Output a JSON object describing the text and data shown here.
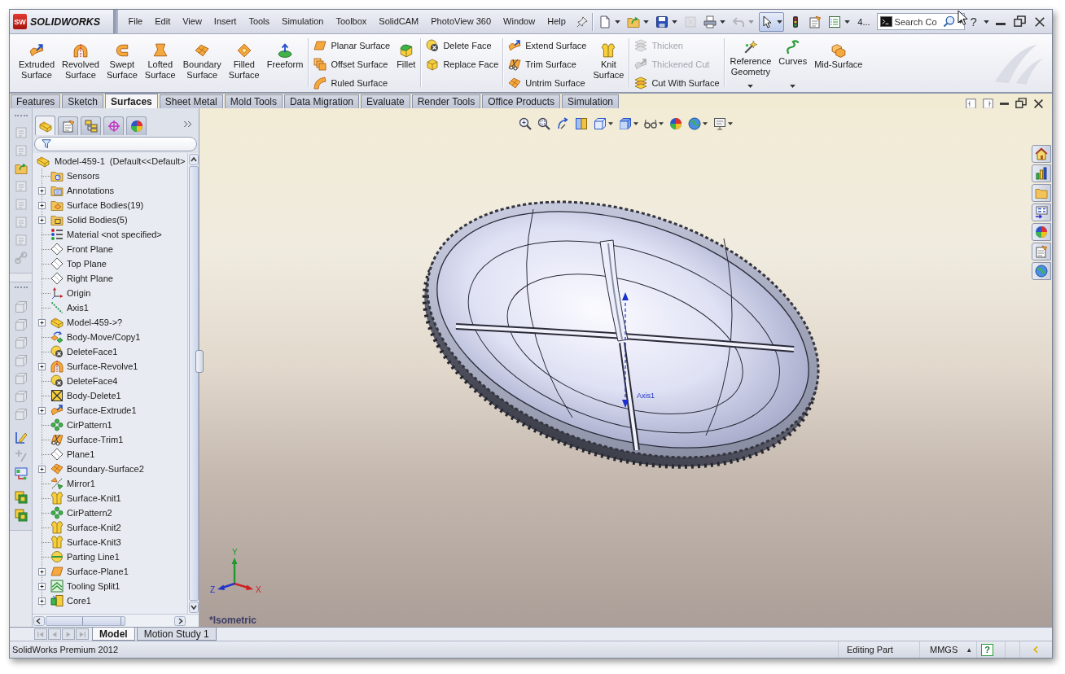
{
  "menubar": {
    "logo": {
      "badge": "SW",
      "name": "SOLIDWORKS"
    },
    "menu": [
      "File",
      "Edit",
      "View",
      "Insert",
      "Tools",
      "Simulation",
      "Toolbox",
      "SolidCAM",
      "PhotoView 360",
      "Window",
      "Help"
    ],
    "quick_access": [
      {
        "dropdown": true,
        "disabled": false,
        "pressed": false
      },
      {
        "dropdown": true,
        "disabled": false,
        "pressed": false
      },
      {
        "dropdown": true,
        "disabled": false,
        "pressed": false
      },
      {
        "dropdown": false,
        "disabled": true,
        "pressed": false
      },
      {
        "dropdown": true,
        "disabled": false,
        "pressed": false
      },
      {
        "dropdown": true,
        "disabled": true,
        "pressed": false
      },
      {
        "dropdown": true,
        "disabled": false,
        "pressed": true
      },
      {
        "dropdown": false,
        "disabled": false,
        "pressed": false
      },
      {
        "dropdown": false,
        "disabled": false,
        "pressed": false
      },
      {
        "dropdown": true,
        "disabled": false,
        "pressed": false
      }
    ],
    "overflow": "4...",
    "search": {
      "placeholder": "Search Co"
    },
    "help": "?"
  },
  "ribbon": [
    [
      {
        "kind": "large",
        "label": "Extruded\nSurface",
        "dropdown": false
      },
      {
        "kind": "large",
        "label": "Revolved\nSurface",
        "dropdown": false
      },
      {
        "kind": "large",
        "label": "Swept\nSurface",
        "dropdown": false
      },
      {
        "kind": "large",
        "label": "Lofted\nSurface",
        "dropdown": false
      },
      {
        "kind": "large",
        "label": "Boundary\nSurface",
        "dropdown": false
      },
      {
        "kind": "large",
        "label": "Filled\nSurface",
        "dropdown": false
      },
      {
        "kind": "large",
        "label": "Freeform",
        "dropdown": false
      }
    ],
    [
      {
        "kind": "stack",
        "buttons": [
          {
            "label": "Planar Surface",
            "disabled": false
          },
          {
            "label": "Offset Surface",
            "disabled": false
          },
          {
            "label": "Ruled Surface",
            "disabled": false
          }
        ]
      },
      {
        "kind": "large",
        "label": "Fillet",
        "dropdown": false
      }
    ],
    [
      {
        "kind": "stack",
        "buttons": [
          {
            "label": "Delete Face",
            "disabled": false
          },
          {
            "label": "Replace Face",
            "disabled": false
          }
        ]
      }
    ],
    [
      {
        "kind": "stack",
        "buttons": [
          {
            "label": "Extend Surface",
            "disabled": false
          },
          {
            "label": "Trim Surface",
            "disabled": false
          },
          {
            "label": "Untrim Surface",
            "disabled": false
          }
        ]
      },
      {
        "kind": "large",
        "label": "Knit\nSurface",
        "dropdown": false
      }
    ],
    [
      {
        "kind": "stack",
        "buttons": [
          {
            "label": "Thicken",
            "disabled": true
          },
          {
            "label": "Thickened Cut",
            "disabled": true
          },
          {
            "label": "Cut With Surface",
            "disabled": false
          }
        ]
      }
    ],
    [
      {
        "kind": "large",
        "label": "Reference\nGeometry",
        "dropdown": true
      },
      {
        "kind": "large",
        "label": "Curves",
        "dropdown": true
      },
      {
        "kind": "large",
        "label": "Mid-Surface",
        "dropdown": false
      }
    ]
  ],
  "command_tabs": [
    {
      "label": "Features",
      "selected": false
    },
    {
      "label": "Sketch",
      "selected": false
    },
    {
      "label": "Surfaces",
      "selected": true
    },
    {
      "label": "Sheet Metal",
      "selected": false
    },
    {
      "label": "Mold Tools",
      "selected": false
    },
    {
      "label": "Data Migration",
      "selected": false
    },
    {
      "label": "Evaluate",
      "selected": false
    },
    {
      "label": "Render Tools",
      "selected": false
    },
    {
      "label": "Office Products",
      "selected": false
    },
    {
      "label": "Simulation",
      "selected": false
    }
  ],
  "left_toolbar": {
    "top": [
      {
        "disabled": true
      },
      {
        "disabled": true
      },
      {
        "disabled": false
      },
      {
        "disabled": true
      },
      {
        "disabled": true
      },
      {
        "disabled": true
      },
      {
        "disabled": true
      },
      {
        "disabled": true
      }
    ],
    "bottom": [
      {
        "disabled": true
      },
      {
        "disabled": true
      },
      {
        "disabled": true
      },
      {
        "disabled": true
      },
      {
        "disabled": true
      },
      {
        "disabled": true
      },
      {
        "disabled": true
      },
      {
        "disabled": false
      },
      {
        "disabled": true
      },
      {
        "disabled": false
      },
      {
        "disabled": false
      },
      {
        "disabled": false
      }
    ]
  },
  "feature_manager": {
    "tabs": [
      {
        "selected": true
      },
      {
        "selected": false
      },
      {
        "selected": false
      },
      {
        "selected": false
      },
      {
        "selected": false
      }
    ],
    "tree": [
      {
        "label": "Model-459-1  (Default<<Default>",
        "kind": "part",
        "children": [
          {
            "label": "Sensors",
            "kind": "sensors"
          },
          {
            "label": "Annotations",
            "kind": "annotations",
            "expanded": false
          },
          {
            "label": "Surface Bodies(19)",
            "kind": "bodies",
            "expanded": false
          },
          {
            "label": "Solid Bodies(5)",
            "kind": "solids",
            "expanded": false
          },
          {
            "label": "Material <not specified>",
            "kind": "material"
          },
          {
            "label": "Front Plane",
            "kind": "plane"
          },
          {
            "label": "Top Plane",
            "kind": "plane"
          },
          {
            "label": "Right Plane",
            "kind": "plane"
          },
          {
            "label": "Origin",
            "kind": "origin"
          },
          {
            "label": "Axis1",
            "kind": "axis"
          },
          {
            "label": "Model-459->?",
            "kind": "part",
            "expanded": false
          },
          {
            "label": "Body-Move/Copy1",
            "kind": "move"
          },
          {
            "label": "DeleteFace1",
            "kind": "deleteface"
          },
          {
            "label": "Surface-Revolve1",
            "kind": "revolve",
            "expanded": false
          },
          {
            "label": "DeleteFace4",
            "kind": "deleteface"
          },
          {
            "label": "Body-Delete1",
            "kind": "bodydelete"
          },
          {
            "label": "Surface-Extrude1",
            "kind": "extrude",
            "expanded": false
          },
          {
            "label": "CirPattern1",
            "kind": "pattern"
          },
          {
            "label": "Surface-Trim1",
            "kind": "trim"
          },
          {
            "label": "Plane1",
            "kind": "plane"
          },
          {
            "label": "Boundary-Surface2",
            "kind": "boundary",
            "expanded": false
          },
          {
            "label": "Mirror1",
            "kind": "mirror"
          },
          {
            "label": "Surface-Knit1",
            "kind": "knit"
          },
          {
            "label": "CirPattern2",
            "kind": "pattern"
          },
          {
            "label": "Surface-Knit2",
            "kind": "knit"
          },
          {
            "label": "Surface-Knit3",
            "kind": "knit"
          },
          {
            "label": "Parting Line1",
            "kind": "partingline"
          },
          {
            "label": "Surface-Plane1",
            "kind": "surfaceplane",
            "expanded": false
          },
          {
            "label": "Tooling Split1",
            "kind": "toolingsplit",
            "expanded": false
          },
          {
            "label": "Core1",
            "kind": "core",
            "expanded": false
          }
        ]
      }
    ]
  },
  "viewport": {
    "view_toolbar": [
      {
        "dropdown": false
      },
      {
        "dropdown": false
      },
      {
        "dropdown": false
      },
      {
        "dropdown": false
      },
      {
        "dropdown": true
      },
      {
        "dropdown": true
      },
      {
        "dropdown": true
      },
      {
        "dropdown": false
      },
      {
        "dropdown": true
      },
      {
        "dropdown": true
      }
    ],
    "axis_label": "Axis1",
    "triad": {
      "x": "X",
      "y": "Y",
      "z": "Z"
    },
    "view_name": "*Isometric"
  },
  "bottom_tabs": {
    "nav": [
      {
        "disabled": true
      },
      {
        "disabled": true
      },
      {
        "disabled": true
      },
      {
        "disabled": true
      }
    ],
    "tabs": [
      {
        "label": "Model",
        "selected": true
      },
      {
        "label": "Motion Study 1",
        "selected": false
      }
    ]
  },
  "status_bar": {
    "product": "SolidWorks Premium 2012",
    "mode": "Editing Part",
    "units": "MMGS",
    "units_menu": "▲",
    "help": "?"
  }
}
